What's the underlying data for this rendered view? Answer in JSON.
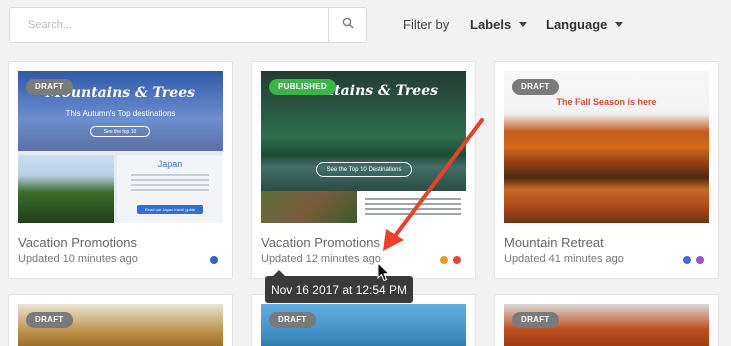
{
  "search": {
    "placeholder": "Search..."
  },
  "filter": {
    "label": "Filter by",
    "labels_dropdown": "Labels",
    "language_dropdown": "Language"
  },
  "cards": [
    {
      "status": "DRAFT",
      "title": "Vacation Promotions",
      "updated": "Updated 10 minutes ago",
      "thumb": {
        "heading": "Mountains & Trees",
        "subheading": "This Autumn's Top destinations",
        "button": "See the top 10",
        "panel_heading": "Japan",
        "panel_button": "Read our Japan travel guide"
      },
      "label_colors": [
        "#2e64d8"
      ]
    },
    {
      "status": "PUBLISHED",
      "title": "Vacation Promotions",
      "updated": "Updated 12 minutes ago",
      "thumb": {
        "heading": "Mountains & Trees",
        "button": "See the Top 10 Destinations"
      },
      "label_colors": [
        "#e8992a",
        "#e0483a"
      ]
    },
    {
      "status": "DRAFT",
      "title": "Mountain Retreat",
      "updated": "Updated 41 minutes ago",
      "thumb": {
        "heading": "The Fall Season is here"
      },
      "label_colors": [
        "#4a63e0",
        "#9a52c8"
      ]
    }
  ],
  "bottom_cards": [
    {
      "status": "DRAFT"
    },
    {
      "status": "DRAFT"
    },
    {
      "status": "DRAFT"
    }
  ],
  "tooltip": {
    "text": "Nov 16 2017 at 12:54 PM"
  },
  "colors": {
    "draft_badge": "#7a7a7a",
    "published_badge": "#3bb54a",
    "annotation_arrow": "#e8412c"
  }
}
